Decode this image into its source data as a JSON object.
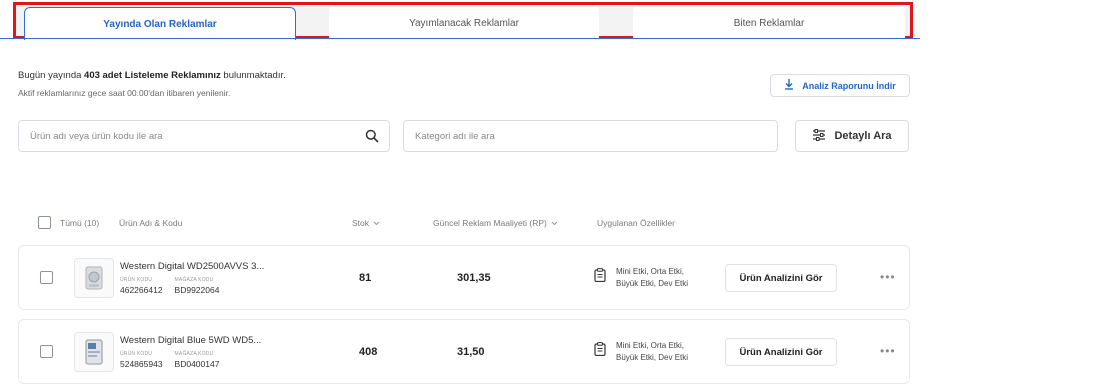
{
  "tabs": [
    {
      "label": "Yayında Olan Reklamlar",
      "active": true
    },
    {
      "label": "Yayımlanacak Reklamlar",
      "active": false
    },
    {
      "label": "Biten Reklamlar",
      "active": false
    }
  ],
  "summary": {
    "prefix": "Bugün yayında ",
    "count_text": "403 adet Listeleme Reklamınız",
    "suffix": " bulunmaktadır.",
    "subtext": "Aktif reklamlarınız gece saat 00.00'dan itibaren yenilenir."
  },
  "report_button": {
    "label": "Analiz Raporunu İndir",
    "icon": "download-icon"
  },
  "search": {
    "product_placeholder": "Ürün adı veya ürün kodu ile ara",
    "category_placeholder": "Kategori adı ile ara",
    "detail_label": "Detaylı Ara"
  },
  "table_header": {
    "all": "Tümü (10)",
    "product": "Ürün Adı & Kodu",
    "stock": "Stok",
    "cost": "Güncel Reklam Maaliyeti (RP)",
    "features": "Uygulanan Özellikler"
  },
  "rows": [
    {
      "name": "Western Digital WD2500AVVS 3...",
      "product_code_label": "ÜRÜN KODU",
      "product_code": "462266412",
      "store_code_label": "MAĞAZA KODU",
      "store_code": "BD9922064",
      "stock": "81",
      "cost": "301,35",
      "features_line1": "Mini Etki, Orta Etki,",
      "features_line2": "Büyük Etki, Dev Etki",
      "action": "Ürün Analizini Gör",
      "more": "•••"
    },
    {
      "name": "Western Digital Blue 5WD WD5...",
      "product_code_label": "ÜRÜN KODU",
      "product_code": "524865943",
      "store_code_label": "MAĞAZA KODU",
      "store_code": "BD0400147",
      "stock": "408",
      "cost": "31,50",
      "features_line1": "Mini Etki, Orta Etki,",
      "features_line2": "Büyük Etki, Dev Etki",
      "action": "Ürün Analizini Gör",
      "more": "•••"
    }
  ],
  "colors": {
    "accent": "#2563c9",
    "highlight": "#e0161e"
  }
}
